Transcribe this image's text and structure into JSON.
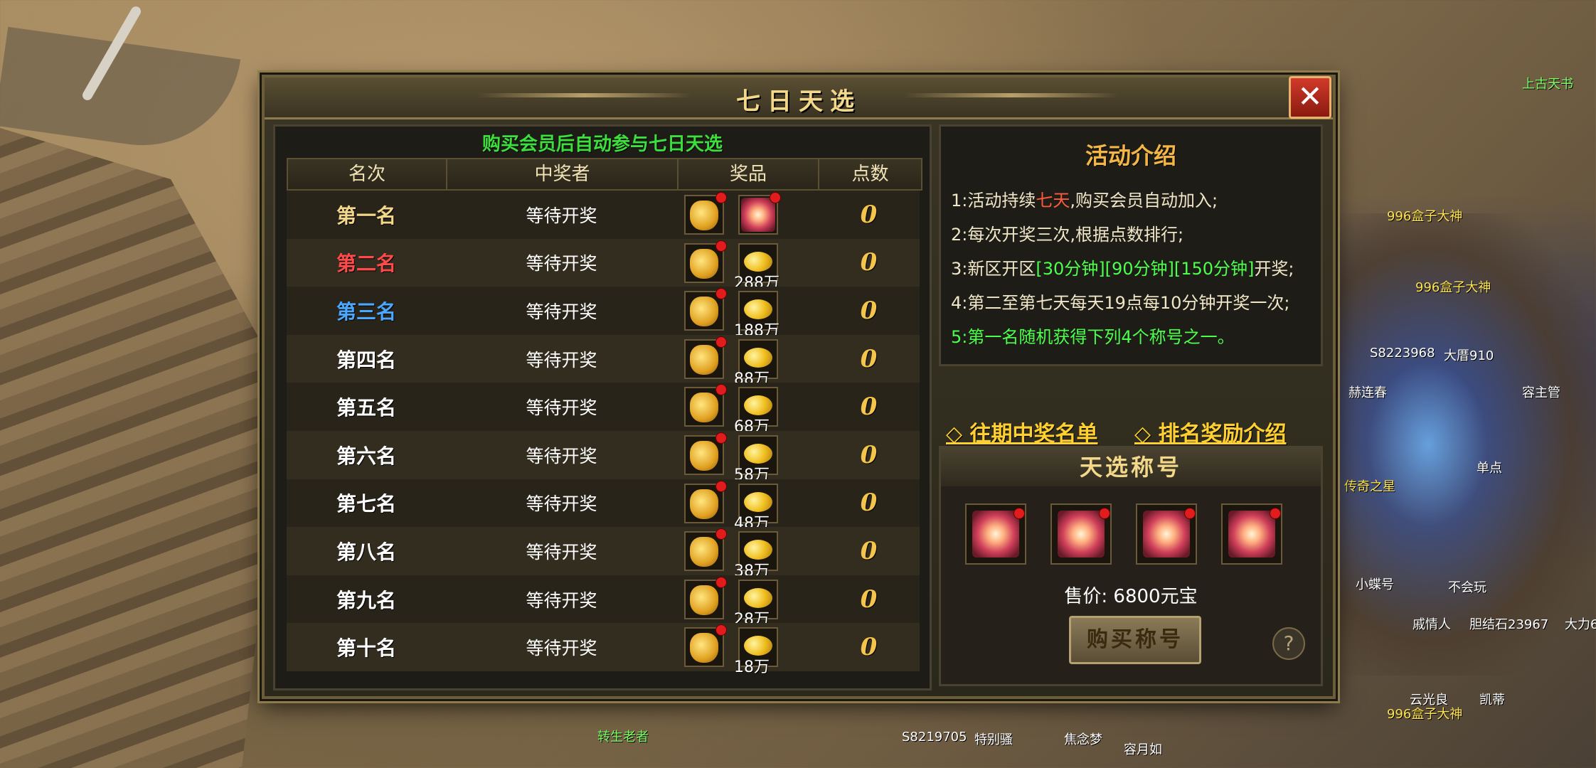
{
  "dialog": {
    "title": "七日天选",
    "close_label": "✕",
    "banner": "购买会员后自动参与七日天选"
  },
  "table": {
    "headers": [
      "名次",
      "中奖者",
      "奖品",
      "点数"
    ],
    "rows": [
      {
        "rank": "第一名",
        "rank_color": "#f3d88a",
        "winner": "等待开奖",
        "prize_qty": "",
        "points": "0"
      },
      {
        "rank": "第二名",
        "rank_color": "#ff4a4a",
        "winner": "等待开奖",
        "prize_qty": "288万",
        "points": "0"
      },
      {
        "rank": "第三名",
        "rank_color": "#4aa8ff",
        "winner": "等待开奖",
        "prize_qty": "188万",
        "points": "0"
      },
      {
        "rank": "第四名",
        "rank_color": "#ffffff",
        "winner": "等待开奖",
        "prize_qty": "88万",
        "points": "0"
      },
      {
        "rank": "第五名",
        "rank_color": "#ffffff",
        "winner": "等待开奖",
        "prize_qty": "68万",
        "points": "0"
      },
      {
        "rank": "第六名",
        "rank_color": "#ffffff",
        "winner": "等待开奖",
        "prize_qty": "58万",
        "points": "0"
      },
      {
        "rank": "第七名",
        "rank_color": "#ffffff",
        "winner": "等待开奖",
        "prize_qty": "48万",
        "points": "0"
      },
      {
        "rank": "第八名",
        "rank_color": "#ffffff",
        "winner": "等待开奖",
        "prize_qty": "38万",
        "points": "0"
      },
      {
        "rank": "第九名",
        "rank_color": "#ffffff",
        "winner": "等待开奖",
        "prize_qty": "28万",
        "points": "0"
      },
      {
        "rank": "第十名",
        "rank_color": "#ffffff",
        "winner": "等待开奖",
        "prize_qty": "18万",
        "points": "0"
      }
    ]
  },
  "intro": {
    "title": "活动介绍",
    "line1_a": "1:活动持续",
    "line1_hl": "七天",
    "line1_b": ",购买会员自动加入;",
    "line2": "2:每次开奖三次,根据点数排行;",
    "line3_a": "3:新区开区",
    "line3_hl": "[30分钟][90分钟][150分钟]",
    "line3_b": "开奖;",
    "line4": "4:第二至第七天每天19点每10分钟开奖一次;",
    "line5": "5:第一名随机获得下列4个称号之一。"
  },
  "links": {
    "history": "◇ 往期中奖名单",
    "rewards": "◇ 排名奖励介绍"
  },
  "titles_box": {
    "header": "天选称号",
    "price": "售价: 6800元宝",
    "buy_label": "购买称号",
    "help_label": "?"
  },
  "world": {
    "labels": [
      "996盒子大神",
      "996盒子大神",
      "996盒子大神",
      "转生老者",
      "S8219705",
      "特别骚",
      "焦念梦",
      "容月如",
      "云光良",
      "凯蒂",
      "上古天书",
      "容主管",
      "单点",
      "传奇之星",
      "S8223968",
      "大厝910",
      "赫连春",
      "小蝶号",
      "不会玩",
      "戚情人",
      "胆结石23967",
      "大力6"
    ]
  }
}
